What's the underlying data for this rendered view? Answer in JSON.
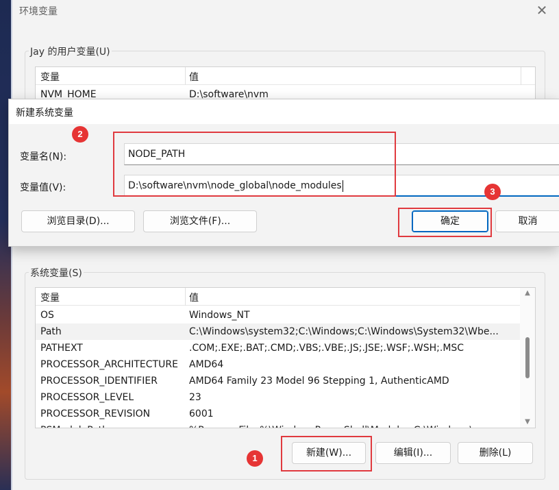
{
  "window": {
    "title": "环境变量",
    "close_glyph": "✕"
  },
  "user_vars": {
    "legend": "Jay 的用户变量(U)",
    "col_name": "变量",
    "col_value": "值",
    "rows": [
      {
        "name": "NVM_HOME",
        "value": "D:\\software\\nvm"
      }
    ]
  },
  "system_vars": {
    "legend": "系统变量(S)",
    "col_name": "变量",
    "col_value": "值",
    "rows": [
      {
        "name": "OS",
        "value": "Windows_NT"
      },
      {
        "name": "Path",
        "value": "C:\\Windows\\system32;C:\\Windows;C:\\Windows\\System32\\Wbe..."
      },
      {
        "name": "PATHEXT",
        "value": ".COM;.EXE;.BAT;.CMD;.VBS;.VBE;.JS;.JSE;.WSF;.WSH;.MSC"
      },
      {
        "name": "PROCESSOR_ARCHITECTURE",
        "value": "AMD64"
      },
      {
        "name": "PROCESSOR_IDENTIFIER",
        "value": "AMD64 Family 23 Model 96 Stepping 1, AuthenticAMD"
      },
      {
        "name": "PROCESSOR_LEVEL",
        "value": "23"
      },
      {
        "name": "PROCESSOR_REVISION",
        "value": "6001"
      },
      {
        "name": "PSModulePath",
        "value": "%ProgramFiles%\\WindowsPowerShell\\Modules;C:\\Windows\\..."
      }
    ],
    "buttons": {
      "new": "新建(W)...",
      "edit": "编辑(I)...",
      "delete": "删除(L)"
    }
  },
  "dialog": {
    "title": "新建系统变量",
    "name_label": "变量名(N):",
    "name_value": "NODE_PATH",
    "value_label": "变量值(V):",
    "value_value": "D:\\software\\nvm\\node_global\\node_modules",
    "buttons": {
      "browse_dir": "浏览目录(D)...",
      "browse_file": "浏览文件(F)...",
      "ok": "确定",
      "cancel": "取消"
    }
  },
  "annotations": {
    "step1": "1",
    "step2": "2",
    "step3": "3"
  },
  "colors": {
    "accent": "#0067c0",
    "annotation_red": "#e0393e",
    "badge_red": "#e63434"
  }
}
